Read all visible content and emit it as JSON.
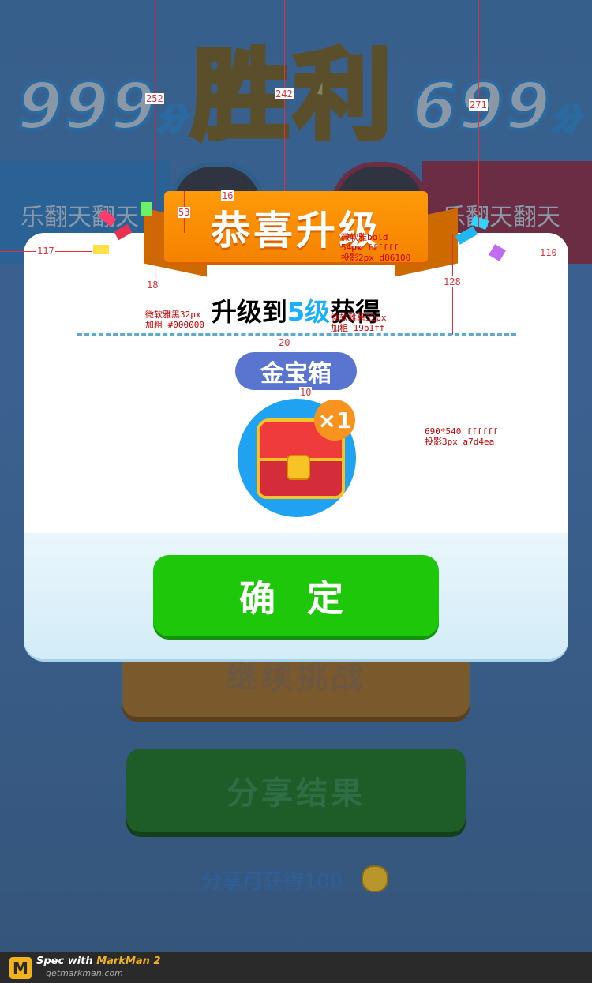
{
  "background": {
    "left_score": "999",
    "right_score": "699",
    "score_unit": "分",
    "result_title": "胜利",
    "left_player": "乐翻天翻天",
    "right_player": "乐翻天翻天",
    "continue_label": "继续挑战",
    "share_label": "分享结果",
    "share_reward": "分享可获得100"
  },
  "dialog": {
    "ribbon_title": "恭喜升级",
    "upgrade_prefix": "升级到",
    "upgrade_level": "5级",
    "upgrade_suffix": "获得",
    "reward_name": "金宝箱",
    "reward_qty": "×1",
    "confirm_label": "确 定"
  },
  "annotations": {
    "dim_252": "252",
    "dim_242": "242",
    "dim_271": "271",
    "dim_53": "53",
    "dim_16": "16",
    "dim_117": "117",
    "dim_110": "110",
    "dim_18": "18",
    "dim_128": "128",
    "dim_20": "20",
    "dim_10": "10",
    "note_title": "微软雅bold\n54px ffffff\n投影2px d86100",
    "note_black": "微软雅黑32px\n加粗 #000000",
    "note_blue": "微软雅黑32px\n加粗 19b1ff",
    "note_dialog": "690*540 ffffff\n投影3px a7d4ea"
  },
  "footer": {
    "spec_prefix": "Spec with ",
    "brand": "MarkMan 2",
    "url": "getmarkman.com",
    "logo": "M"
  },
  "colors": {
    "ribbon": "#f58200",
    "ribbon_shadow": "#d86100",
    "level_blue": "#19b1ff",
    "confirm_green": "#1fc70a",
    "dialog_shadow": "#a7d4ea",
    "pill": "#5a75cf"
  }
}
